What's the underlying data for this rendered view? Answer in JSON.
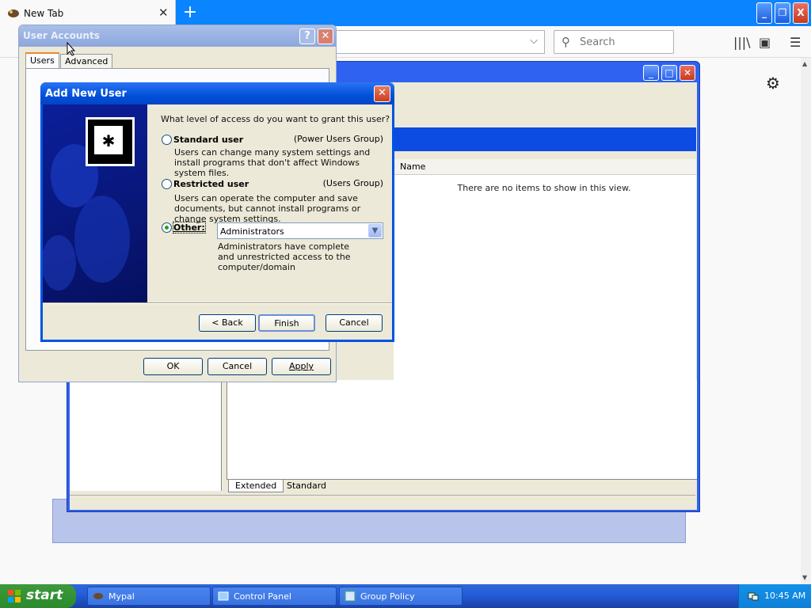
{
  "browser": {
    "tab_title": "New Tab",
    "new_tab_symbol": "+",
    "search_placeholder": "Search",
    "window_buttons": [
      "_",
      "❐",
      "X"
    ]
  },
  "mmc": {
    "list_column_name": "Name",
    "empty_message": "There are no items to show in this view.",
    "view_tabs": [
      "Extended",
      "Standard"
    ]
  },
  "user_accounts": {
    "title": "User Accounts",
    "tabs": [
      "Users",
      "Advanced"
    ],
    "buttons": {
      "ok": "OK",
      "cancel": "Cancel",
      "apply": "Apply"
    }
  },
  "add_new_user": {
    "title": "Add New User",
    "question": "What level of access do you want to grant this user?",
    "options": [
      {
        "label": "Standard user",
        "group": "(Power Users Group)",
        "description": "Users can change many system settings and install programs that don't affect Windows system files.",
        "selected": false
      },
      {
        "label": "Restricted user",
        "group": "(Users Group)",
        "description": "Users can operate the computer and save documents, but cannot install programs or change system settings.",
        "selected": false
      },
      {
        "label": "Other:",
        "group": "",
        "description": "Administrators have complete and unrestricted access to the computer/domain",
        "selected": true
      }
    ],
    "other_select_value": "Administrators",
    "buttons": {
      "back": "< Back",
      "finish": "Finish",
      "cancel": "Cancel"
    }
  },
  "taskbar": {
    "start_label": "start",
    "tasks": [
      "Mypal",
      "Control Panel",
      "Group Policy"
    ],
    "clock": "10:45 AM"
  },
  "colors": {
    "xp_blue": "#0054e3",
    "firefox_blue": "#0a84ff",
    "start_green": "#3c9a3c"
  }
}
